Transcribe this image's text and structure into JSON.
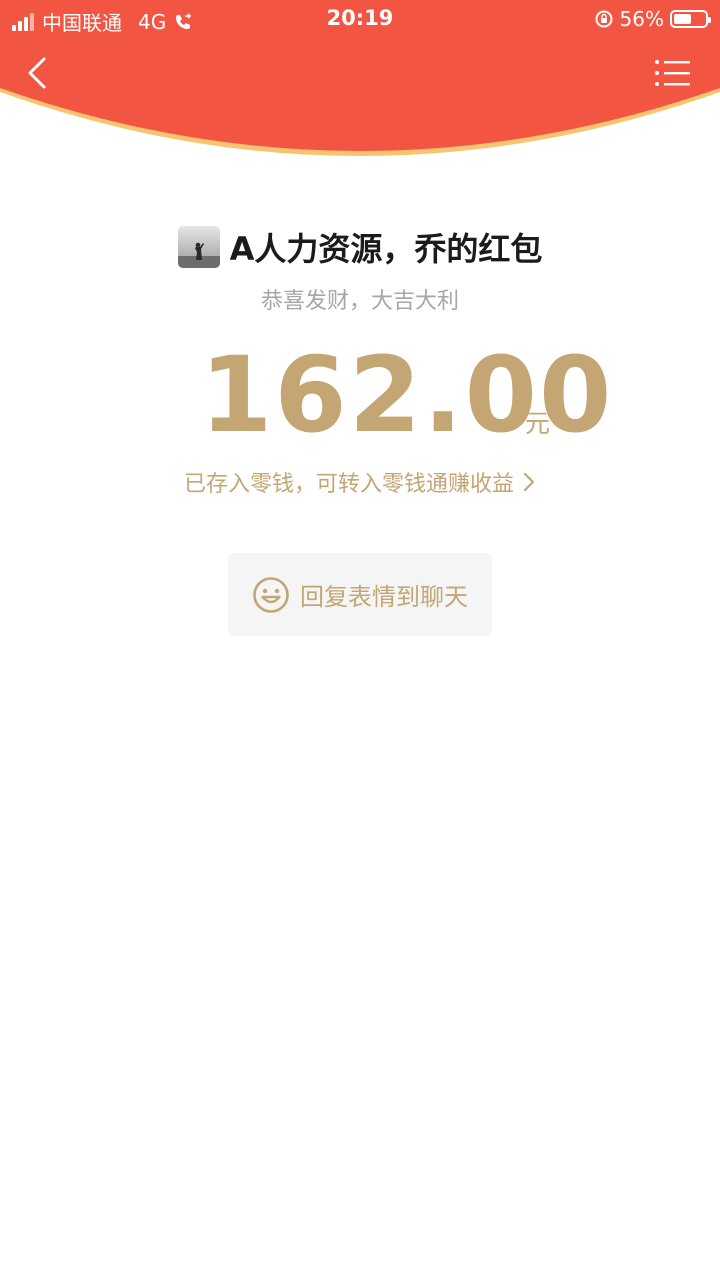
{
  "status_bar": {
    "carrier": "中国联通",
    "network": "4G",
    "time": "20:19",
    "battery_percent": "56%",
    "battery_level": 0.56
  },
  "icons": {
    "back": "chevron-left-icon",
    "menu": "list-menu-icon",
    "smile": "smile-face-icon"
  },
  "colors": {
    "header_red": "#f25542",
    "gold": "#c4a574",
    "curve_border": "#f7c470"
  },
  "red_packet": {
    "sender": "A人力资源，乔的红包",
    "blessing": "恭喜发财，大吉大利",
    "amount": "162.00",
    "currency": "元",
    "wallet_note": "已存入零钱，可转入零钱通赚收益"
  },
  "actions": {
    "reply_label": "回复表情到聊天"
  }
}
